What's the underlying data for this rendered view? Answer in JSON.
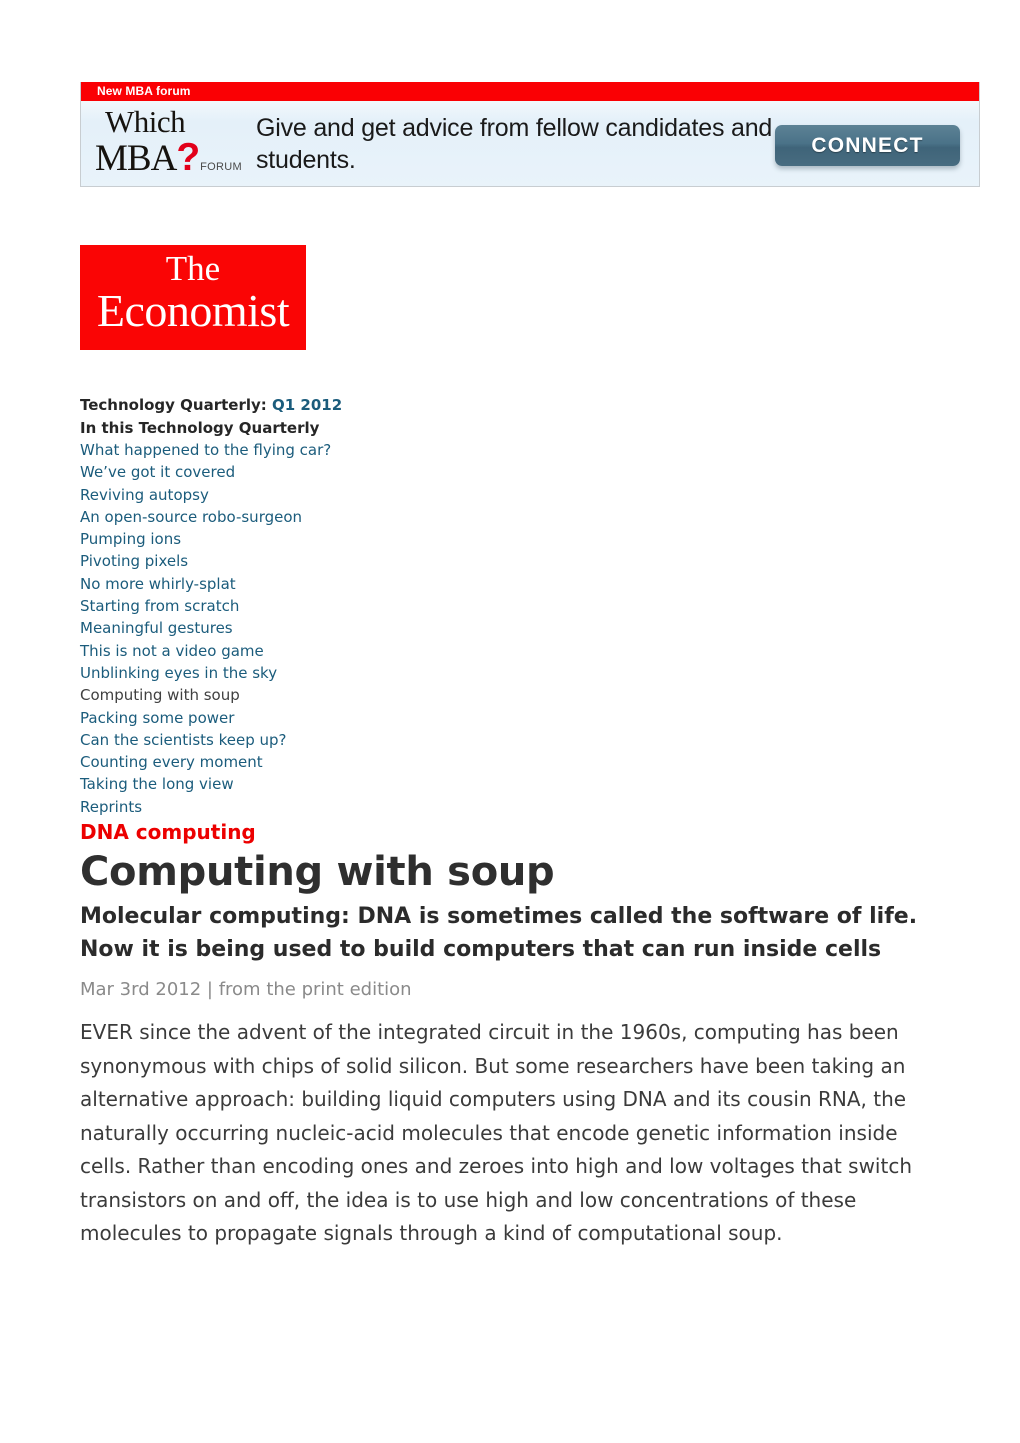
{
  "ad": {
    "strip_label": "New MBA forum",
    "logo": {
      "line1": "Which",
      "line2_main": "MBA",
      "line2_mark": "?",
      "line2_suffix": "FORUM"
    },
    "tagline": "Give and get advice from fellow candidates and students.",
    "cta_label": "CONNECT",
    "strip_color": "#fa0004",
    "cta_color": "#4a7288"
  },
  "masthead": {
    "logo_line1": "The",
    "logo_line2": "Economist",
    "logo_color": "#fa0505"
  },
  "tq": {
    "heading_prefix": "Technology Quarterly: ",
    "heading_issue": "Q1 2012",
    "subheading": "In this Technology Quarterly",
    "link_color": "#1b5c7c",
    "items": [
      {
        "label": "What happened to the flying car?",
        "current": false
      },
      {
        "label": "We’ve got it covered",
        "current": false
      },
      {
        "label": "Reviving autopsy",
        "current": false
      },
      {
        "label": "An open-source robo-surgeon",
        "current": false
      },
      {
        "label": "Pumping ions",
        "current": false
      },
      {
        "label": "Pivoting pixels",
        "current": false
      },
      {
        "label": "No more whirly-splat",
        "current": false
      },
      {
        "label": "Starting from scratch",
        "current": false
      },
      {
        "label": "Meaningful gestures",
        "current": false
      },
      {
        "label": "This is not a video game",
        "current": false
      },
      {
        "label": "Unblinking eyes in the sky",
        "current": false
      },
      {
        "label": "Computing with soup",
        "current": true
      },
      {
        "label": "Packing some power",
        "current": false
      },
      {
        "label": "Can the scientists keep up?",
        "current": false
      },
      {
        "label": "Counting every moment",
        "current": false
      },
      {
        "label": "Taking the long view",
        "current": false
      },
      {
        "label": "Reprints",
        "current": false
      }
    ]
  },
  "article": {
    "kicker": "DNA computing",
    "kicker_color": "#ec0000",
    "headline": "Computing with soup",
    "subhead": "Molecular computing: DNA is sometimes called the software of life. Now it is being used to build computers that can run inside cells",
    "date": "Mar 3rd 2012",
    "byline_separator": " | ",
    "source": "from the print edition",
    "body": "EVER since the advent of the integrated circuit in the 1960s, computing has been synonymous with chips of solid silicon. But some researchers have been taking an alternative approach: building liquid computers using DNA and its cousin RNA, the naturally occurring nucleic-acid molecules that encode genetic information inside cells. Rather than encoding ones and zeroes into high and low voltages that switch transistors on and off, the idea is to use high and low concentrations of these molecules to propagate signals through a kind of computational soup."
  }
}
